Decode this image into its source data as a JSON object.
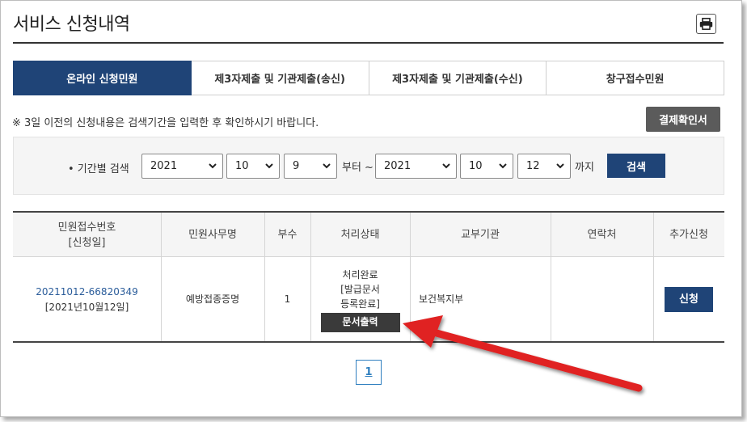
{
  "page": {
    "title": "서비스 신청내역"
  },
  "tabs": [
    {
      "label": "온라인 신청민원",
      "active": true
    },
    {
      "label": "제3자제출 및 기관제출(송신)",
      "active": false
    },
    {
      "label": "제3자제출 및 기관제출(수신)",
      "active": false
    },
    {
      "label": "창구접수민원",
      "active": false
    }
  ],
  "notice": "※ 3일 이전의 신청내용은 검색기간을 입력한 후 확인하시기 바랍니다.",
  "confirm_button": "결제확인서",
  "search": {
    "label": "• 기간별 검색",
    "from_year": "2021",
    "from_month": "10",
    "from_day": "9",
    "from_word": "부터 ~",
    "to_year": "2021",
    "to_month": "10",
    "to_day": "12",
    "to_word": "까지",
    "button": "검색"
  },
  "table": {
    "headers": {
      "receipt_line1": "민원접수번호",
      "receipt_line2": "[신청일]",
      "service": "민원사무명",
      "copies": "부수",
      "status": "처리상태",
      "agency": "교부기관",
      "contact": "연락처",
      "extra": "추가신청"
    },
    "rows": [
      {
        "receipt_no": "20211012-66820349",
        "date": "[2021년10월12일]",
        "service": "예방접종증명",
        "copies": "1",
        "status_line1": "처리완료",
        "status_line2": "[발급문서",
        "status_line3": "등록완료]",
        "print_button": "문서출력",
        "agency": "보건복지부",
        "contact": "",
        "apply_button": "신청"
      }
    ]
  },
  "pagination": {
    "current": "1"
  },
  "colors": {
    "primary": "#1f4477",
    "annotation_arrow": "#e02020"
  },
  "icons": {
    "print": "printer-icon",
    "select": "chevron-down-icon"
  }
}
